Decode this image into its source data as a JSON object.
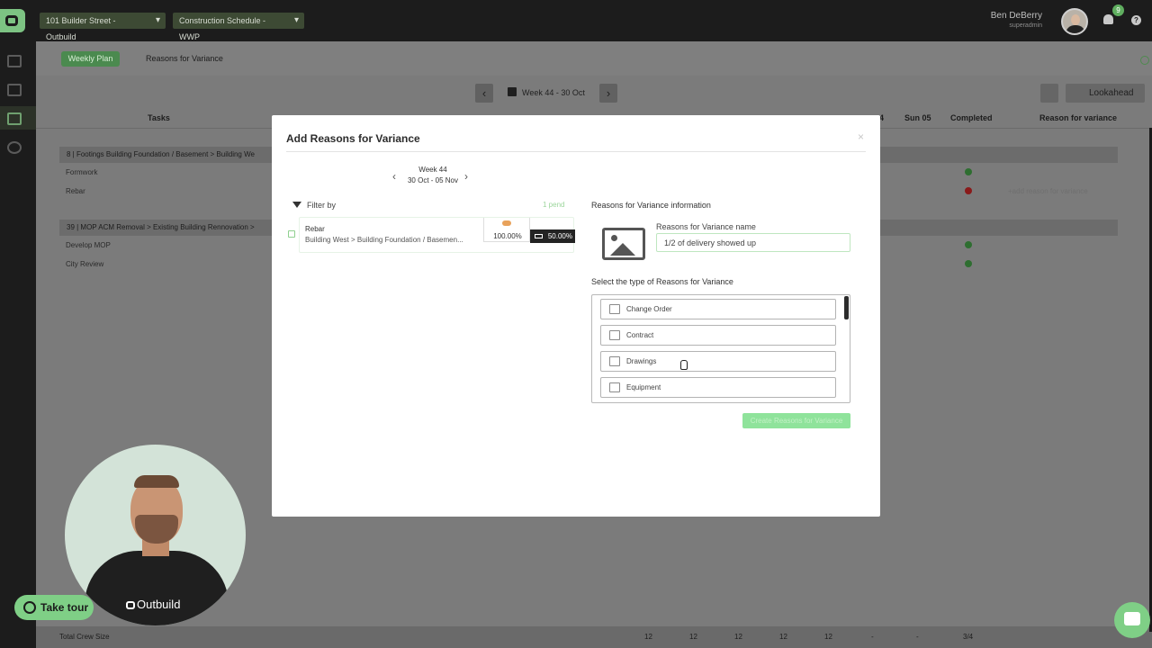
{
  "header": {
    "project": "101 Builder Street - Outbuild",
    "schedule": "Construction Schedule - WWP",
    "user_name": "Ben DeBerry",
    "user_role": "superadmin",
    "notifications": "9",
    "help": "?"
  },
  "tabs": {
    "weekly_plan": "Weekly Plan",
    "reasons_for_variance": "Reasons for Variance"
  },
  "week_nav": {
    "label": "Week 44 - 30 Oct"
  },
  "toolbar": {
    "lookahead": "Lookahead"
  },
  "table": {
    "headers": {
      "tasks": "Tasks",
      "day4": "4",
      "sun": "Sun 05",
      "completed": "Completed",
      "rfv": "Reason for variance"
    },
    "groups": [
      {
        "label": "8 | Footings  Building Foundation / Basement > Building We",
        "tasks": [
          {
            "name": "Formwork",
            "status": "ok"
          },
          {
            "name": "Rebar",
            "status": "bad",
            "rfv": "+add reason for variance"
          }
        ]
      },
      {
        "label": "39 | MOP  ACM Removal > Existing Building Rennovation >",
        "tasks": [
          {
            "name": "Develop MOP",
            "status": "ok"
          },
          {
            "name": "City Review",
            "status": "ok"
          }
        ]
      }
    ],
    "footer": {
      "label": "Total Crew Size",
      "values": [
        "12",
        "12",
        "12",
        "12",
        "12",
        "-",
        "-",
        "3/4"
      ]
    }
  },
  "modal": {
    "title": "Add Reasons for Variance",
    "close": "×",
    "week_title": "Week 44",
    "week_range": "30 Oct - 05 Nov",
    "prev": "‹",
    "next": "›",
    "filter_label": "Filter by",
    "pending": "1 pend",
    "task": {
      "name": "Rebar",
      "path": "Building West > Building Foundation / Basemen...",
      "planned_pct": "100.00%",
      "actual_pct": "50.00%"
    },
    "info_heading": "Reasons for Variance information",
    "name_label": "Reasons for Variance name",
    "name_value": "1/2 of delivery showed up",
    "type_label": "Select the type of Reasons for Variance",
    "types": [
      "Change Order",
      "Contract",
      "Drawings",
      "Equipment"
    ],
    "create_button": "Create Reasons for Variance"
  },
  "presenter": {
    "logo_text": "Outbuild"
  },
  "take_tour": "Take tour",
  "colors": {
    "accent": "#7fcf86",
    "dark": "#1c1c1c"
  }
}
